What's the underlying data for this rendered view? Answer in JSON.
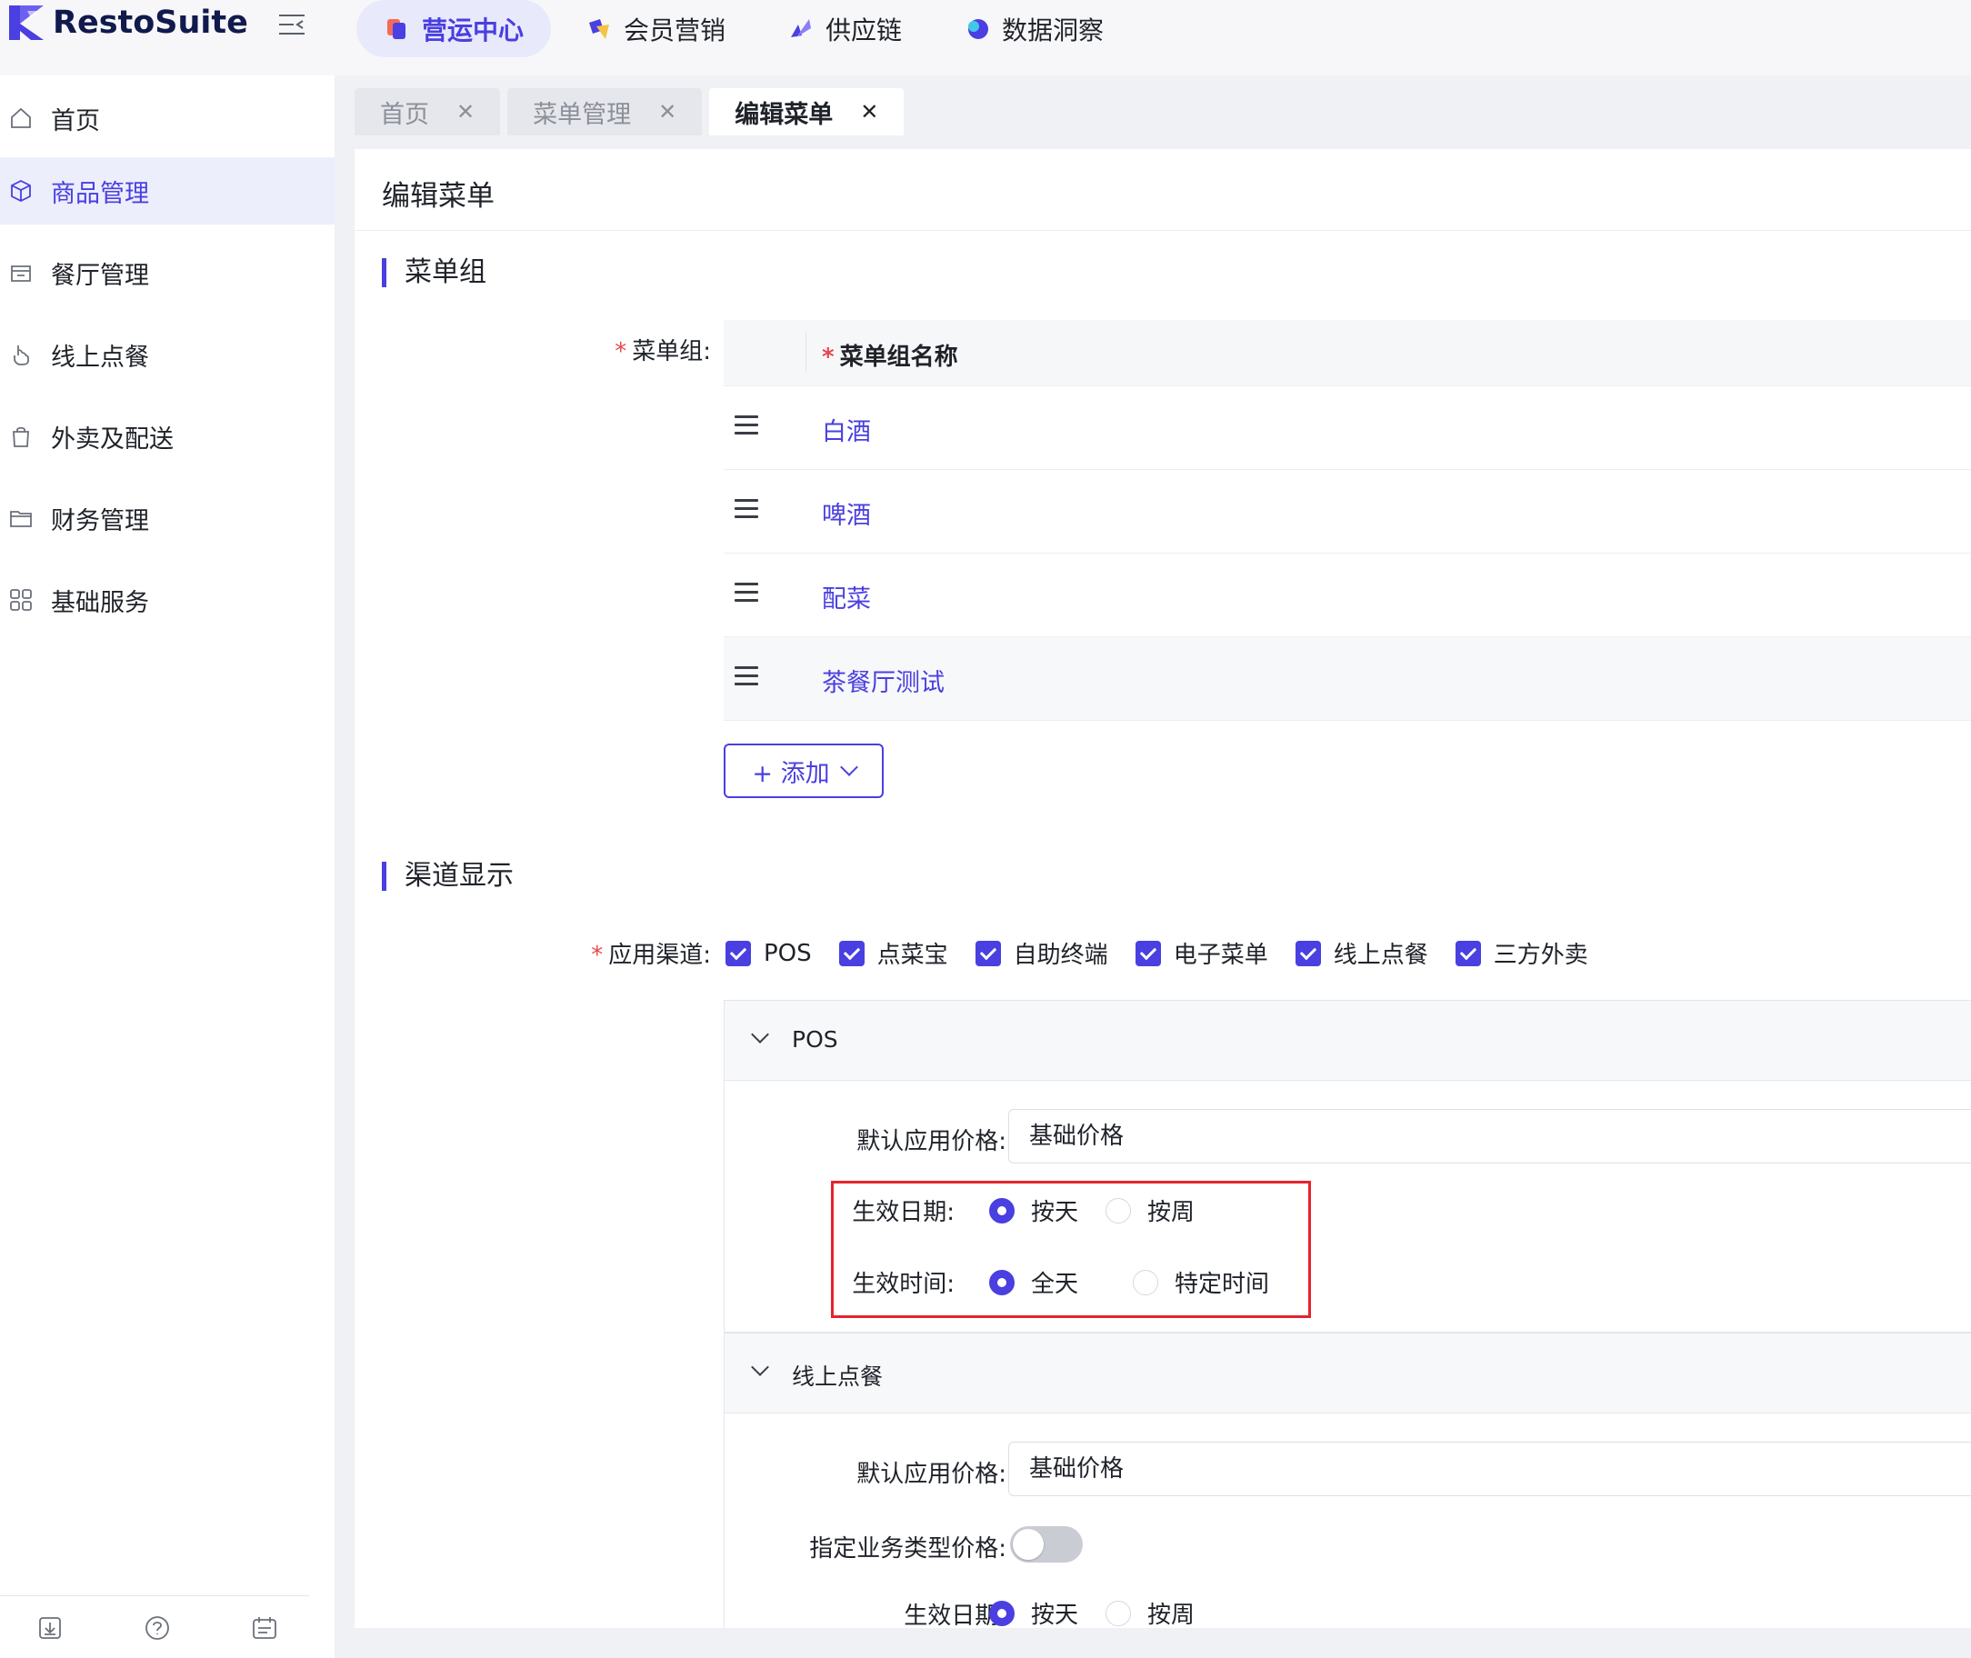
{
  "brand": {
    "name": "RestoSuite",
    "accent": "#4a3fe0"
  },
  "top_nav": [
    {
      "label": "营运中心",
      "icon": "ops-center-icon",
      "active": true
    },
    {
      "label": "会员营销",
      "icon": "member-marketing-icon",
      "active": false
    },
    {
      "label": "供应链",
      "icon": "supply-chain-icon",
      "active": false
    },
    {
      "label": "数据洞察",
      "icon": "data-insight-icon",
      "active": false
    }
  ],
  "sidebar": {
    "items": [
      {
        "label": "首页",
        "icon": "home-icon"
      },
      {
        "label": "商品管理",
        "icon": "box-icon",
        "active": true
      },
      {
        "label": "餐厅管理",
        "icon": "store-icon"
      },
      {
        "label": "线上点餐",
        "icon": "tap-icon"
      },
      {
        "label": "外卖及配送",
        "icon": "bag-icon"
      },
      {
        "label": "财务管理",
        "icon": "folder-icon"
      },
      {
        "label": "基础服务",
        "icon": "grid-icon"
      }
    ],
    "footer_icons": [
      "download-icon",
      "help-icon",
      "calendar-icon"
    ]
  },
  "tabs": [
    {
      "label": "首页",
      "active": false
    },
    {
      "label": "菜单管理",
      "active": false
    },
    {
      "label": "编辑菜单",
      "active": true
    }
  ],
  "page": {
    "title": "编辑菜单",
    "section_menu_group": "菜单组",
    "section_channel": "渠道显示"
  },
  "menu_group": {
    "label": "菜单组:",
    "column_header": "菜单组名称",
    "rows": [
      "白酒",
      "啤酒",
      "配菜",
      "茶餐厅测试"
    ],
    "add_label": "+ 添加"
  },
  "channels": {
    "label": "应用渠道:",
    "options": [
      "POS",
      "点菜宝",
      "自助终端",
      "电子菜单",
      "线上点餐",
      "三方外卖"
    ]
  },
  "pos_panel": {
    "title": "POS",
    "price_label": "默认应用价格:",
    "price_value": "基础价格",
    "date_label": "生效日期:",
    "date_options": [
      "按天",
      "按周"
    ],
    "time_label": "生效时间:",
    "time_options": [
      "全天",
      "特定时间"
    ]
  },
  "online_panel": {
    "title": "线上点餐",
    "price_label": "默认应用价格:",
    "price_value": "基础价格",
    "biz_price_label": "指定业务类型价格:",
    "date_label": "生效日期:",
    "date_options": [
      "按天",
      "按周"
    ]
  }
}
